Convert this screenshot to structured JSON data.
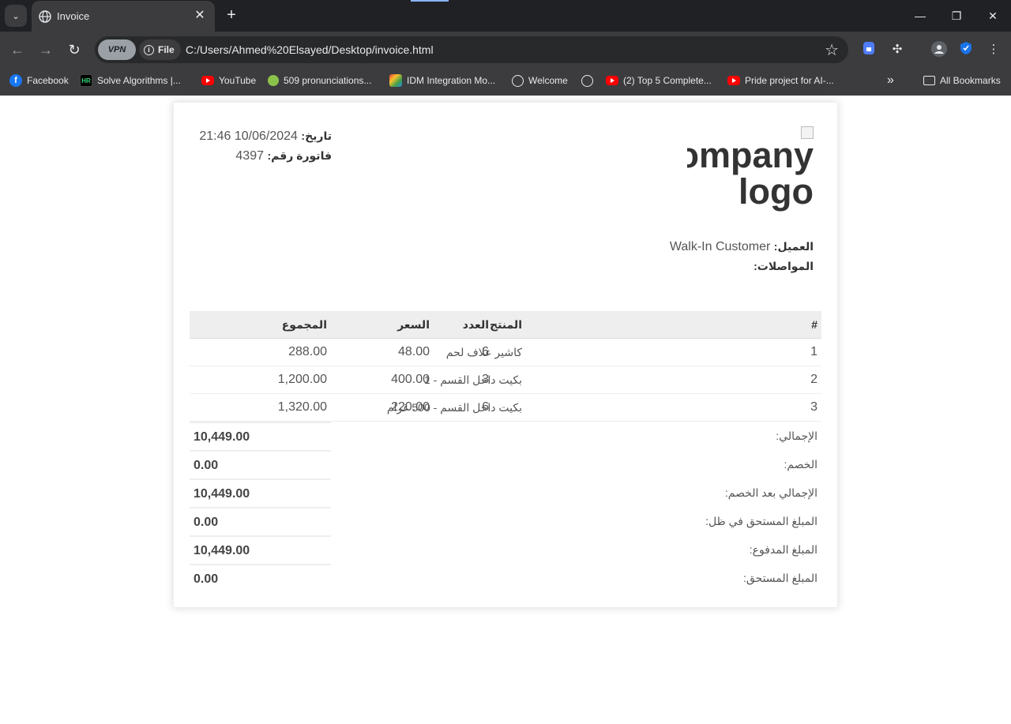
{
  "browser": {
    "tab_title": "Invoice",
    "url_chip": "File",
    "vpn_label": "VPN",
    "url": "C:/Users/Ahmed%20Elsayed/Desktop/invoice.html",
    "bookmarks": [
      {
        "label": "Facebook",
        "icon": "facebook-icon"
      },
      {
        "label": "Solve Algorithms |...",
        "icon": "hackerrank-icon"
      },
      {
        "label": "YouTube",
        "icon": "youtube-icon"
      },
      {
        "label": "509 pronunciations...",
        "icon": "forvo-icon"
      },
      {
        "label": "IDM Integration Mo...",
        "icon": "idm-icon"
      },
      {
        "label": "Welcome",
        "icon": "globe-icon"
      },
      {
        "label": "",
        "icon": "globe-icon"
      },
      {
        "label": "(2) Top 5 Complete...",
        "icon": "youtube-icon"
      },
      {
        "label": "Pride project for AI-...",
        "icon": "youtube-icon"
      }
    ],
    "all_bookmarks": "All Bookmarks"
  },
  "invoice": {
    "date_label": "تاريخ:",
    "date_value": "10/06/2024 21:46",
    "number_label": "فاتورة رقم:",
    "number_value": "4397",
    "logo_alt": "Company logo",
    "customer_label": "العميل:",
    "customer_value": "Walk-In Customer",
    "transport_label": "المواصلات:",
    "headers": {
      "num": "#",
      "product": "المنتج",
      "qty": "العدد",
      "price": "السعر",
      "total": "المجموع"
    },
    "items": [
      {
        "num": "1",
        "product": "كاشير علاف لحم",
        "qty": "6",
        "price": "48.00",
        "total": "288.00"
      },
      {
        "num": "2",
        "product": "بكيت داخل القسم - 1",
        "qty": "3",
        "price": "400.00",
        "total": "1,200.00"
      },
      {
        "num": "3",
        "product": "بكيت داخل القسم - 500 غرام",
        "qty": "6",
        "price": "220.00",
        "total": "1,320.00"
      }
    ],
    "totals": [
      {
        "label": "الإجمالي:",
        "value": "10,449.00"
      },
      {
        "label": "الخصم:",
        "value": "0.00"
      },
      {
        "label": "الإجمالي بعد الخصم:",
        "value": "10,449.00"
      },
      {
        "label": "المبلغ المستحق في ظل:",
        "value": "0.00"
      },
      {
        "label": "المبلغ المدفوع:",
        "value": "10,449.00"
      },
      {
        "label": "المبلغ المستحق:",
        "value": "0.00"
      }
    ]
  }
}
